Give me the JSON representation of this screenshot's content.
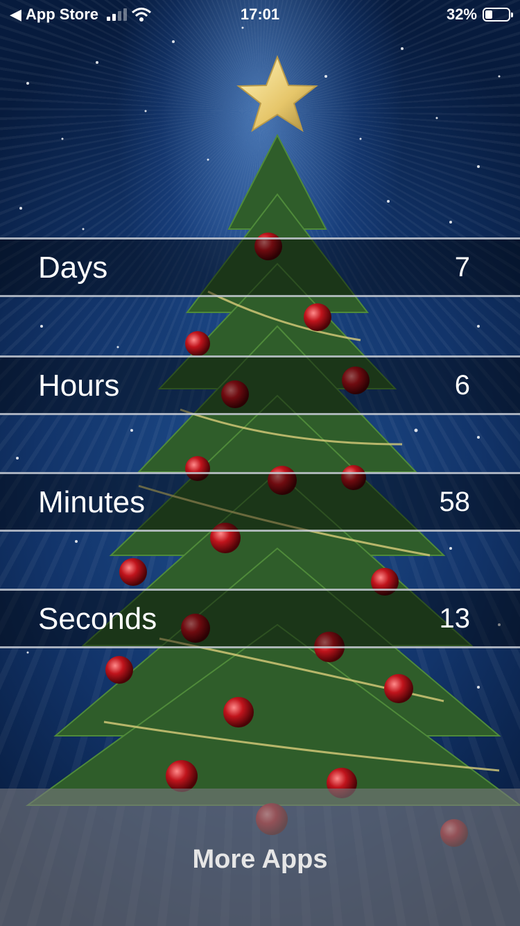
{
  "status_bar": {
    "back_app": "App Store",
    "time": "17:01",
    "battery": "32%",
    "battery_fraction": 0.32
  },
  "countdown": [
    {
      "label": "Days",
      "value": "7"
    },
    {
      "label": "Hours",
      "value": "6"
    },
    {
      "label": "Minutes",
      "value": "58"
    },
    {
      "label": "Seconds",
      "value": "13"
    }
  ],
  "more_apps_label": "More Apps"
}
